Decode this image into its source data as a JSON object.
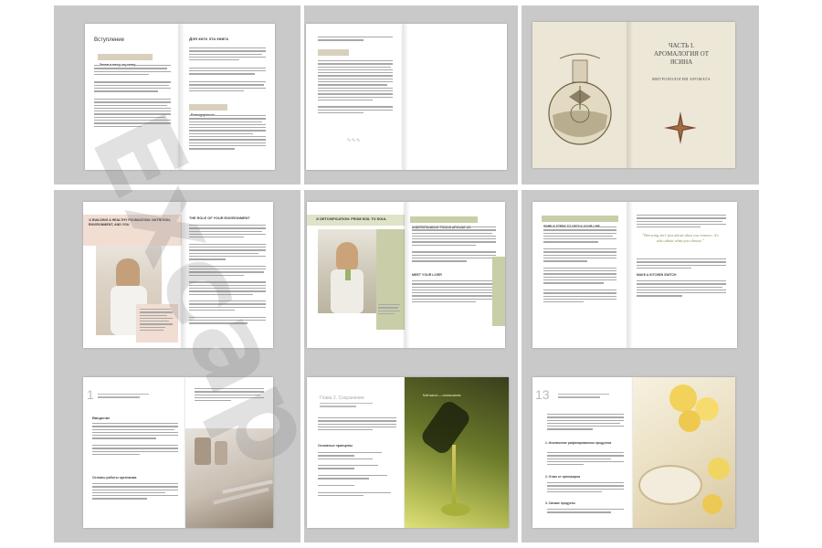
{
  "watermark": {
    "text": "Excap"
  },
  "panels": {
    "p1": {
      "left_title": "Вступление",
      "left_tag": "Зачем я пишу эту книгу",
      "right_title": "Для кого эта книга",
      "right_tag": "Благодарности"
    },
    "p3": {
      "chapter": "ЧАСТЬ I.",
      "title_line1": "АРОМАЛОГИЯ ОТ",
      "title_line2": "ЯСИНА",
      "subtitle": "МИТРОПОЛОГИЯ АРОМАТА"
    },
    "p4": {
      "left_heading": "1/ BUILDING A HEALTHY FOUNDATION: NUTRITION, ENVIRONMENT, AND YOU",
      "right_heading": "THE ROLE OF YOUR ENVIRONMENT"
    },
    "p5": {
      "left_heading": "2/ DETOXIFICATION: FROM SOIL TO SOUL",
      "right_heading": "UNDERSTANDING TOXINS AROUND US",
      "right_sub": "MEET YOUR LIVER"
    },
    "p6": {
      "left_heading": "SIMPLE STEPS TO DETOX YOUR LIFE",
      "quote": "\"Detoxing isn't just about what you remove; it's also about what you choose.\"",
      "sub": "MAKE A KITCHEN SWITCH"
    },
    "p7": {
      "number": "1",
      "title": "Введение",
      "sub": "Основы работы организма"
    },
    "p8": {
      "title": "Глава 2. Сохранение",
      "sub": "Основные принципы",
      "quote": "Моё масло — основа жизни"
    },
    "p9": {
      "number": "13",
      "sub1": "1. Исключение рафинированных продуктов",
      "sub2": "2. Отказ от трансжиров",
      "sub3": "3. Свежие продукты"
    }
  }
}
